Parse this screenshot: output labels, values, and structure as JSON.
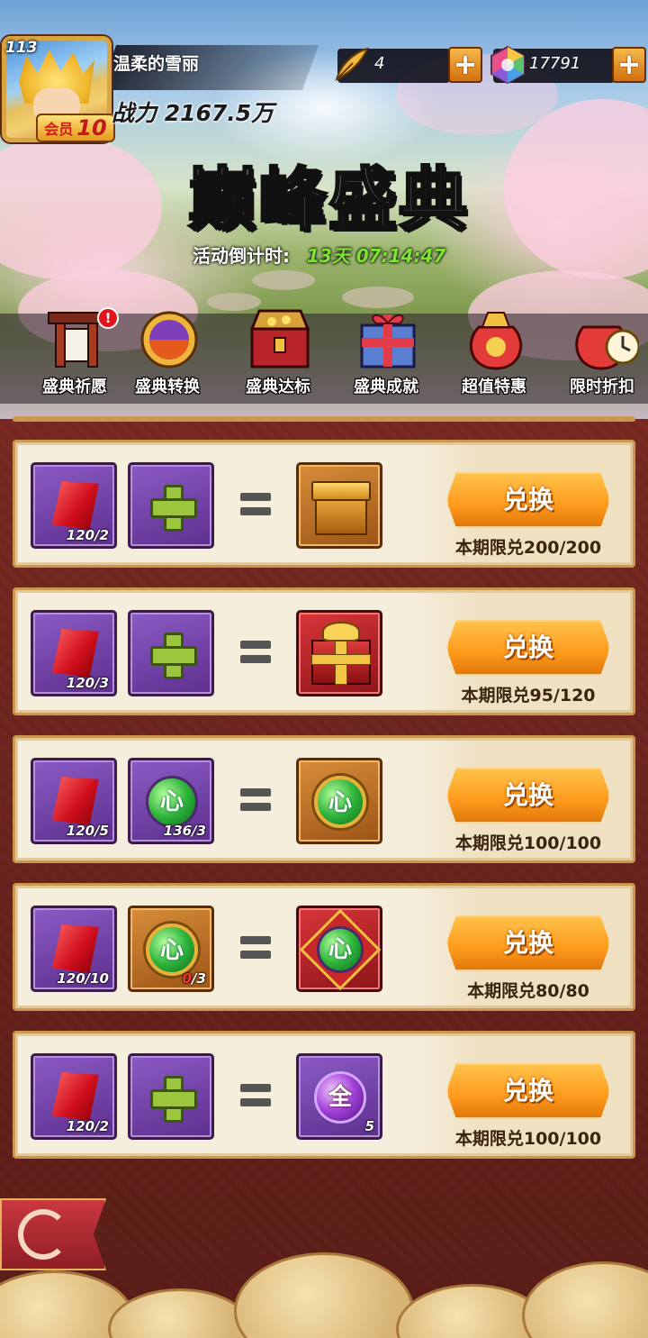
{
  "player": {
    "level": "113",
    "name": "温柔的雪丽",
    "vip_label": "会员",
    "vip_level": "10",
    "power": "战力 2167.5万"
  },
  "resources": {
    "feather": {
      "icon": "feather-icon",
      "value": "4"
    },
    "gem": {
      "icon": "rainbow-gem-icon",
      "value": "17791"
    },
    "plus_label": "+"
  },
  "event": {
    "title": "巅峰盛典",
    "countdown_label": "活动倒计时:",
    "countdown_value": "13天 07:14:47"
  },
  "tabs": [
    {
      "label": "盛典祈愿",
      "icon": "shrine-icon",
      "alert": "!"
    },
    {
      "label": "盛典转换",
      "icon": "orb-exchange-icon"
    },
    {
      "label": "盛典达标",
      "icon": "treasure-chest-icon"
    },
    {
      "label": "盛典成就",
      "icon": "gift-box-icon"
    },
    {
      "label": "超值特惠",
      "icon": "money-bag-icon"
    },
    {
      "label": "限时折扣",
      "icon": "clock-bag-icon"
    }
  ],
  "exchanges": [
    {
      "inputs": [
        {
          "icon": "red-crystal-icon",
          "count": "120/2"
        },
        {
          "icon": "plus-icon",
          "count": ""
        }
      ],
      "output": {
        "icon": "golden-chest-icon",
        "count": ""
      },
      "button": "兑换",
      "limit": "本期限兑200/200"
    },
    {
      "inputs": [
        {
          "icon": "red-crystal-icon",
          "count": "120/3"
        },
        {
          "icon": "plus-icon",
          "count": ""
        }
      ],
      "output": {
        "icon": "red-gift-box-icon",
        "count": ""
      },
      "button": "兑换",
      "limit": "本期限兑95/120"
    },
    {
      "inputs": [
        {
          "icon": "red-crystal-icon",
          "count": "120/5"
        },
        {
          "icon": "green-heart-orb-icon",
          "orb_text": "心",
          "count_have": "136",
          "count_need": "/3"
        }
      ],
      "output": {
        "icon": "framed-green-heart-orb-icon",
        "orb_text": "心",
        "count": ""
      },
      "button": "兑换",
      "limit": "本期限兑100/100"
    },
    {
      "inputs": [
        {
          "icon": "red-crystal-icon",
          "count": "120/10"
        },
        {
          "icon": "framed-green-heart-orb-icon",
          "orb_text": "心",
          "count_have": "0",
          "count_need": "/3"
        }
      ],
      "output": {
        "icon": "diamond-green-heart-orb-icon",
        "orb_text": "心",
        "count": ""
      },
      "button": "兑换",
      "limit": "本期限兑80/80"
    },
    {
      "inputs": [
        {
          "icon": "red-crystal-icon",
          "count": "120/2"
        },
        {
          "icon": "plus-icon",
          "count": ""
        }
      ],
      "output": {
        "icon": "purple-all-orb-icon",
        "orb_text": "全",
        "count": "5"
      },
      "button": "兑换",
      "limit": "本期限兑100/100"
    }
  ],
  "bottom": {
    "flag_icon": "swirl-flag-icon"
  }
}
